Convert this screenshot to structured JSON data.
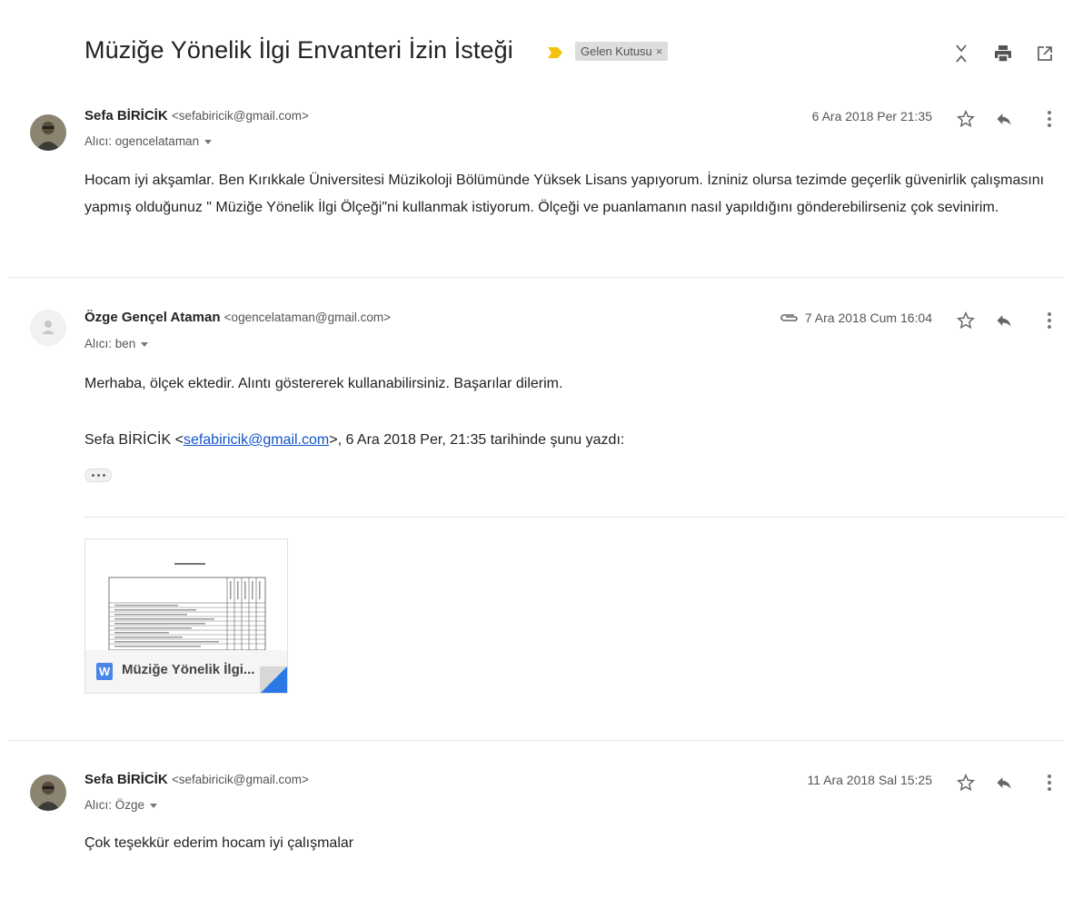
{
  "thread": {
    "subject": "Müziğe Yönelik İlgi Envanteri İzin İsteği",
    "label": "Gelen Kutusu",
    "label_close": "×",
    "importance_color": "#f4c20d"
  },
  "toolbar": {
    "icons": [
      "expand-collapse-icon",
      "print-icon",
      "open-in-new-window-icon"
    ]
  },
  "messages": [
    {
      "sender_name": "Sefa BİRİCİK",
      "sender_email": "<sefabiricik@gmail.com>",
      "to": "Alıcı: ogencelataman",
      "date": "6 Ara 2018 Per 21:35",
      "body": "Hocam iyi akşamlar. Ben Kırıkkale Üniversitesi Müzikoloji Bölümünde Yüksek Lisans yapıyorum. İzniniz olursa tezimde geçerlik güvenirlik çalışmasını yapmış olduğunuz \" Müziğe Yönelik İlgi Ölçeği\"ni  kullanmak istiyorum. Ölçeği ve puanlamanın nasıl yapıldığını gönderebilirseniz çok sevinirim."
    },
    {
      "sender_name": "Özge Gençel Ataman",
      "sender_email": "<ogencelataman@gmail.com>",
      "to": "Alıcı: ben",
      "date": "7 Ara 2018 Cum 16:04",
      "body": "Merhaba, ölçek ektedir. Alıntı göstererek kullanabilirsiniz. Başarılar dilerim.",
      "quote_prefix": "Sefa BİRİCİK <",
      "quote_link": "sefabiricik@gmail.com",
      "quote_suffix": ">, 6 Ara 2018 Per, 21:35 tarihinde şunu yazdı:",
      "attachment": {
        "name": "Müziğe Yönelik İlgi...",
        "type_letter": "W"
      }
    },
    {
      "sender_name": "Sefa BİRİCİK",
      "sender_email": "<sefabiricik@gmail.com>",
      "to": "Alıcı: Özge",
      "date": "11 Ara 2018 Sal 15:25",
      "body": "Çok teşekkür ederim hocam iyi çalışmalar"
    }
  ],
  "colors": {
    "link": "#1155cc",
    "label_bg": "#dddddd",
    "word_blue": "#4a86e8"
  }
}
